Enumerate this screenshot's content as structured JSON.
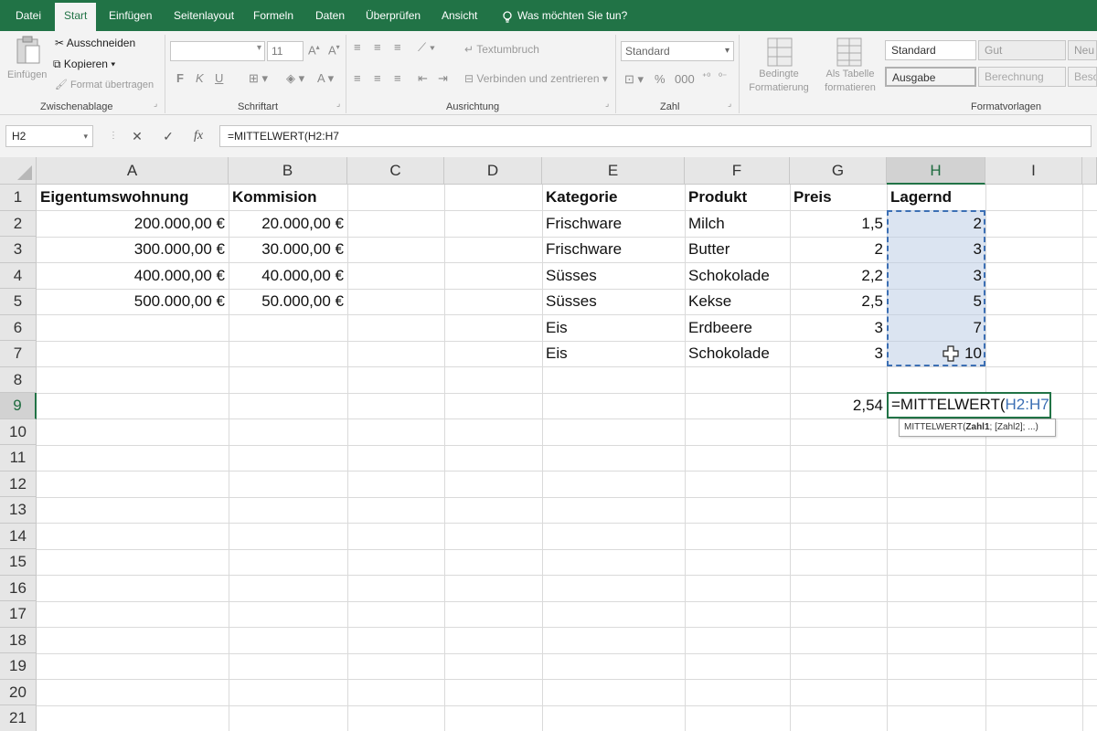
{
  "ribbon_tabs": [
    "Datei",
    "Start",
    "Einfügen",
    "Seitenlayout",
    "Formeln",
    "Daten",
    "Überprüfen",
    "Ansicht"
  ],
  "active_tab": "Start",
  "tell_me": "Was möchten Sie tun?",
  "clipboard": {
    "paste": "Einfügen",
    "cut": "Ausschneiden",
    "copy": "Kopieren",
    "format_painter": "Format übertragen",
    "label": "Zwischenablage"
  },
  "font": {
    "size": "11",
    "bold": "F",
    "italic": "K",
    "underline": "U",
    "label": "Schriftart"
  },
  "alignment": {
    "wrap_text": "Textumbruch",
    "merge_center": "Verbinden und zentrieren",
    "label": "Ausrichtung"
  },
  "number": {
    "format": "Standard",
    "label": "Zahl"
  },
  "styles": {
    "conditional": "Bedingte\nFormatierung",
    "as_table": "Als Tabelle\nformatieren",
    "cells": [
      "Standard",
      "Gut",
      "Neu",
      "Ausgabe",
      "Berechnung",
      "Besc"
    ],
    "label": "Formatvorlagen"
  },
  "formula_bar": {
    "name_box": "H2",
    "cancel": "✕",
    "enter": "✓",
    "fx": "fx",
    "formula": "=MITTELWERT(H2:H7"
  },
  "columns": [
    "A",
    "B",
    "C",
    "D",
    "E",
    "F",
    "G",
    "H",
    "I"
  ],
  "selected_column": "H",
  "rows": [
    "1",
    "2",
    "3",
    "4",
    "5",
    "6",
    "7",
    "8",
    "9",
    "10",
    "11",
    "12",
    "13",
    "14",
    "15",
    "16",
    "17",
    "18",
    "19",
    "20",
    "21"
  ],
  "selected_row": "9",
  "table1": {
    "headers": [
      "Eigentumswohnung",
      "Kommision"
    ],
    "rows": [
      [
        "200.000,00 €",
        "20.000,00 €"
      ],
      [
        "300.000,00 €",
        "30.000,00 €"
      ],
      [
        "400.000,00 €",
        "40.000,00 €"
      ],
      [
        "500.000,00 €",
        "50.000,00 €"
      ]
    ]
  },
  "table2": {
    "headers": [
      "Kategorie",
      "Produkt",
      "Preis",
      "Lagernd"
    ],
    "rows": [
      [
        "Frischware",
        "Milch",
        "1,5",
        "2"
      ],
      [
        "Frischware",
        "Butter",
        "2",
        "3"
      ],
      [
        "Süsses",
        "Schokolade",
        "2,2",
        "3"
      ],
      [
        "Süsses",
        "Kekse",
        "2,5",
        "5"
      ],
      [
        "Eis",
        "Erdbeere",
        "3",
        "7"
      ],
      [
        "Eis",
        "Schokolade",
        "3",
        "10"
      ]
    ]
  },
  "g9_value": "2,54",
  "edit_cell": {
    "prefix": "=MITTELWERT(",
    "ref": "H2:H7"
  },
  "tooltip": {
    "func": "MITTELWERT(",
    "arg1": "Zahl1",
    "rest": "; [Zahl2]; ...)"
  }
}
